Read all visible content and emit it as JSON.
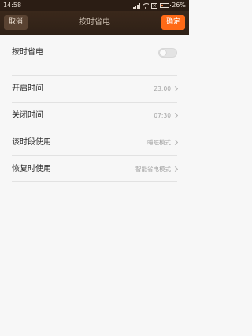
{
  "status_bar": {
    "time": "14:58",
    "battery": "26%",
    "battery_level": 0.26
  },
  "header": {
    "cancel_label": "取消",
    "title": "按时省电",
    "confirm_label": "确定"
  },
  "settings": {
    "toggle": {
      "label": "按时省电",
      "on": false
    },
    "rows": [
      {
        "label": "开启时间",
        "value": "23:00"
      },
      {
        "label": "关闭时间",
        "value": "07:30"
      },
      {
        "label": "该时段使用",
        "value": "睡眠模式"
      },
      {
        "label": "恢复时使用",
        "value": "智能省电模式"
      }
    ]
  },
  "colors": {
    "accent": "#ff6a17",
    "header_bg": "#2f2117",
    "page_bg": "#f7f7f7"
  }
}
